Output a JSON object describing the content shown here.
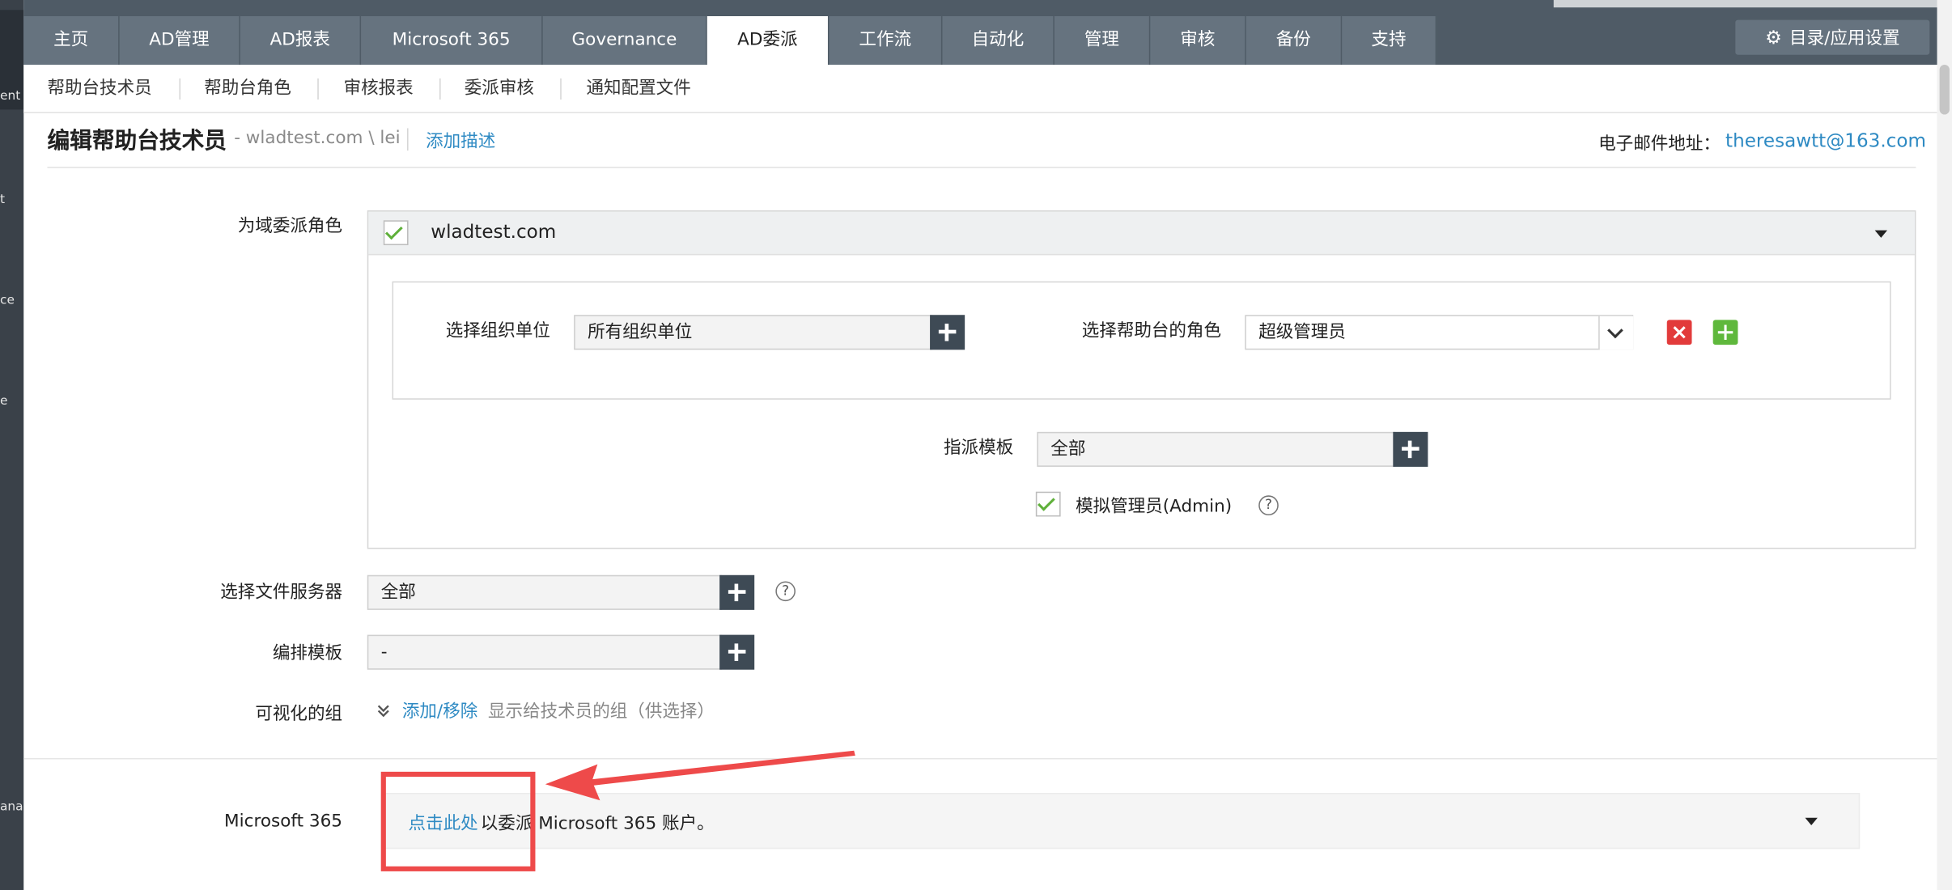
{
  "sidebar": {
    "fragments": [
      "ent",
      "t",
      "ce",
      "e",
      "ana"
    ]
  },
  "topnav": {
    "tabs": [
      {
        "label": "主页"
      },
      {
        "label": "AD管理"
      },
      {
        "label": "AD报表"
      },
      {
        "label": "Microsoft 365"
      },
      {
        "label": "Governance"
      },
      {
        "label": "AD委派",
        "active": true
      },
      {
        "label": "工作流"
      },
      {
        "label": "自动化"
      },
      {
        "label": "管理"
      },
      {
        "label": "审核"
      },
      {
        "label": "备份"
      },
      {
        "label": "支持"
      }
    ],
    "settings_label": "目录/应用设置",
    "settings_icon": "gear-icon"
  },
  "subnav": {
    "items": [
      {
        "label": "帮助台技术员"
      },
      {
        "label": "帮助台角色"
      },
      {
        "label": "审核报表"
      },
      {
        "label": "委派审核"
      },
      {
        "label": "通知配置文件"
      }
    ]
  },
  "header": {
    "title": "编辑帮助台技术员",
    "account": "- wladtest.com \\ lei",
    "add_description": "添加描述",
    "email_label": "电子邮件地址：",
    "email_value": "theresawtt@163.com"
  },
  "form": {
    "domain_role_label": "为域委派角色",
    "domain_name": "wladtest.com",
    "domain_checked": true,
    "ou_label": "选择组织单位",
    "ou_value": "所有组织单位",
    "role_label": "选择帮助台的角色",
    "role_value": "超级管理员",
    "template_label": "指派模板",
    "template_value": "全部",
    "impersonate_label": "模拟管理员(Admin)",
    "impersonate_checked": true,
    "file_server_label": "选择文件服务器",
    "file_server_value": "全部",
    "schedule_template_label": "编排模板",
    "schedule_template_value": "-",
    "visible_groups_label": "可视化的组",
    "visible_groups_link": "添加/移除",
    "visible_groups_text": "显示给技术员的组（供选择）",
    "ms365_label": "Microsoft 365",
    "ms365_link": "点击此处",
    "ms365_text": "以委派 Microsoft 365 账户。"
  },
  "colors": {
    "nav_bg": "#4f5b66",
    "tab_bg": "#66737f",
    "link": "#2e8ac3",
    "check": "#5fb03a",
    "annotation": "#ee4a4a"
  }
}
